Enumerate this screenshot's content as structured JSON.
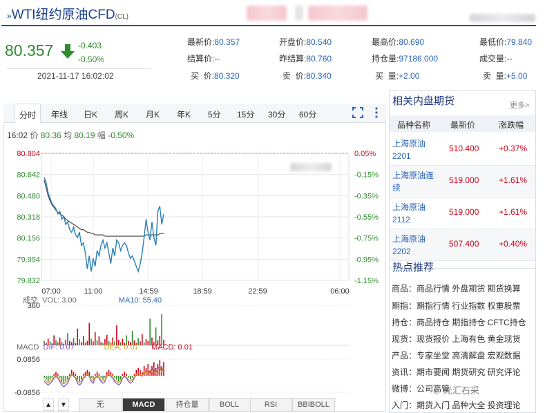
{
  "header": {
    "title": "WTI纽约原油CFD",
    "code": "(CL)",
    "price": "80.357",
    "change": "-0.403",
    "change_pct": "-0.50%",
    "timestamp": "2021-11-17 16:02:02"
  },
  "quote": {
    "row1": [
      {
        "label": "最新价:",
        "value": "80.357"
      },
      {
        "label": "开盘价:",
        "value": "80.540"
      },
      {
        "label": "最高价:",
        "value": "80.690"
      },
      {
        "label": "最低价:",
        "value": "79.840"
      }
    ],
    "row2": [
      {
        "label": "结算价:",
        "value": "--"
      },
      {
        "label": "昨结算:",
        "value": "80.760"
      },
      {
        "label": "持仓量:",
        "value": "97186.000"
      },
      {
        "label": "成交量:",
        "value": "--"
      }
    ],
    "row3": [
      {
        "label": "买  价:",
        "value": "80.320"
      },
      {
        "label": "卖  价:",
        "value": "80.340"
      },
      {
        "label": "买  量:",
        "value": "+2.00"
      },
      {
        "label": "卖  量:",
        "value": "+5.00"
      }
    ]
  },
  "chart_tabs": [
    "分时",
    "年线",
    "日K",
    "周K",
    "月K",
    "年K",
    "5分",
    "15分",
    "30分",
    "60分"
  ],
  "live": {
    "time": "16:02",
    "price_label": "价",
    "price": "80.36",
    "avg_label": "均",
    "avg": "80.19",
    "pct_label": "幅",
    "pct": "-0.50%"
  },
  "chart_data": [
    {
      "type": "line",
      "title": "",
      "y_ticks": [
        "80.804",
        "80.642",
        "80.480",
        "80.318",
        "80.156",
        "79.994",
        "79.832"
      ],
      "y_right_ticks": [
        "0.05%",
        "-0.15%",
        "-0.35%",
        "-0.55%",
        "-0.75%",
        "-0.95%",
        "-1.15%"
      ],
      "x_ticks": [
        "07:00",
        "11:00",
        "14:59",
        "18:59",
        "22:59",
        "06:00"
      ],
      "ylim": [
        79.832,
        80.804
      ],
      "series": [
        {
          "name": "价",
          "values": [
            80.62,
            80.58,
            80.5,
            80.46,
            80.42,
            80.4,
            80.38,
            80.34,
            80.36,
            80.3,
            80.32,
            80.26,
            80.28,
            80.22,
            80.2,
            80.24,
            80.18,
            80.16,
            80.2,
            80.1,
            80.12,
            80.04,
            79.92,
            80.02,
            79.9,
            80.0,
            79.94,
            80.06,
            80.02,
            80.1,
            80.14,
            80.08,
            80.12,
            80.04,
            79.96,
            80.08,
            80.02,
            80.14,
            80.12,
            80.06,
            80.1,
            80.12,
            80.1,
            80.04,
            80.0,
            80.02,
            79.98,
            79.94,
            79.9,
            79.96,
            80.04,
            80.16,
            80.3,
            80.2,
            80.14,
            80.28,
            80.16,
            80.1,
            80.36,
            80.4,
            80.26,
            80.34
          ]
        },
        {
          "name": "均",
          "values": [
            80.6,
            80.54,
            80.48,
            80.44,
            80.41,
            80.39,
            80.37,
            80.35,
            80.34,
            80.33,
            80.32,
            80.3,
            80.29,
            80.28,
            80.27,
            80.26,
            80.25,
            80.24,
            80.23,
            80.22,
            80.22,
            80.21,
            80.2,
            80.2,
            80.19,
            80.19,
            80.18,
            80.18,
            80.18,
            80.18,
            80.18,
            80.17,
            80.17,
            80.17,
            80.17,
            80.17,
            80.17,
            80.17,
            80.17,
            80.17,
            80.17,
            80.17,
            80.17,
            80.17,
            80.17,
            80.17,
            80.17,
            80.17,
            80.17,
            80.17,
            80.17,
            80.17,
            80.18,
            80.18,
            80.18,
            80.18,
            80.18,
            80.18,
            80.18,
            80.19,
            80.19,
            80.19
          ]
        }
      ]
    },
    {
      "type": "bar",
      "title": "成交",
      "labels": {
        "vol": "VOL: 3.00",
        "ma10": "MA10: 55.40"
      },
      "y_ticks": [
        "360"
      ],
      "values": [
        40,
        22,
        60,
        35,
        18,
        90,
        45,
        25,
        70,
        30,
        15,
        50,
        110,
        40,
        28,
        65,
        20,
        150,
        55,
        30,
        85,
        25,
        40,
        200,
        60,
        35,
        120,
        45,
        80,
        30,
        20,
        55,
        95,
        40,
        25,
        70,
        35,
        180,
        50,
        28,
        60,
        22,
        90,
        40,
        30,
        130,
        45,
        20,
        65,
        35,
        100,
        25,
        55,
        40,
        240,
        70,
        30,
        160,
        45,
        85,
        280,
        50
      ]
    },
    {
      "type": "bar",
      "title": "MACD",
      "labels": {
        "dif": "DIF: 0.07",
        "dea": "DEA: 0.07",
        "macd": "MACD: 0.01"
      },
      "y_ticks": [
        "0.0856",
        "-0.0856"
      ],
      "values": [
        -0.01,
        -0.02,
        -0.03,
        -0.02,
        -0.01,
        0.01,
        0.02,
        0.01,
        -0.01,
        -0.03,
        -0.04,
        -0.03,
        -0.02,
        0.01,
        0.03,
        0.02,
        0.01,
        -0.02,
        -0.03,
        -0.02,
        0.01,
        0.02,
        0.03,
        0.02,
        -0.01,
        -0.02,
        0.01,
        0.02,
        0.01,
        -0.01,
        -0.02,
        -0.01,
        0.02,
        0.03,
        0.02,
        0.01,
        -0.01,
        -0.02,
        -0.03,
        -0.02,
        0.01,
        0.02,
        0.01,
        -0.01,
        -0.02,
        -0.01,
        0.01,
        0.03,
        0.04,
        0.03,
        0.02,
        0.05,
        0.04,
        0.06,
        0.03,
        0.05,
        0.07,
        0.04,
        0.06,
        0.08,
        0.05,
        0.07
      ]
    }
  ],
  "bottom_tabs": [
    "无",
    "MACD",
    "持仓量",
    "BOLL",
    "RSI",
    "BBIBOLL"
  ],
  "related": {
    "title": "相关内盘期货",
    "more": "更多>",
    "columns": [
      "品种名称",
      "最新价",
      "涨跌幅"
    ],
    "rows": [
      {
        "name": "上海原油2201",
        "price": "510.400",
        "change": "+0.37%"
      },
      {
        "name": "上海原油连续",
        "price": "519.000",
        "change": "+1.61%"
      },
      {
        "name": "上海原油2112",
        "price": "519.000",
        "change": "+1.61%"
      },
      {
        "name": "上海原油2202",
        "price": "507.400",
        "change": "+0.40%"
      }
    ]
  },
  "hot": {
    "title": "热点推荐",
    "rows": [
      "商品：商品行情 外盘期货 期货换算",
      "期指：期指行情 行业指数 权重股票",
      "持仓：商品持仓 期指持仓 CFTC持仓",
      "现货：现货报价 上海有色 黄金现货",
      "产品：专家坐堂 高清解盘 宏观数据",
      "资讯：期市要闻 期货研究 研究评论",
      "微博：公司高管",
      "入门：期货入门 品种大全 投资理论"
    ]
  },
  "watermark": "光汇石采",
  "colors": {
    "brand": "#1f4e99",
    "up": "#d0021b",
    "down": "#2e8b2e",
    "line": "#2a7db5",
    "avg": "#333333"
  }
}
